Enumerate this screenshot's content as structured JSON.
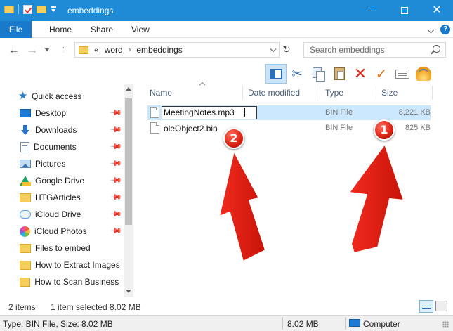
{
  "window": {
    "title": "embeddings"
  },
  "ribbon": {
    "file": "File",
    "tabs": [
      "Home",
      "Share",
      "View"
    ],
    "help": "?"
  },
  "address": {
    "overflow": "«",
    "crumbs": [
      "word",
      "embeddings"
    ],
    "search_placeholder": "Search embeddings"
  },
  "navpane": {
    "quick_access": "Quick access",
    "items": [
      {
        "label": "Desktop",
        "icon": "desktop-icon",
        "pinned": true
      },
      {
        "label": "Downloads",
        "icon": "downloads-icon",
        "pinned": true
      },
      {
        "label": "Documents",
        "icon": "documents-icon",
        "pinned": true
      },
      {
        "label": "Pictures",
        "icon": "pictures-icon",
        "pinned": true
      },
      {
        "label": "Google Drive",
        "icon": "google-drive-icon",
        "pinned": true
      },
      {
        "label": "HTGArticles",
        "icon": "folder-icon",
        "pinned": true
      },
      {
        "label": "iCloud Drive",
        "icon": "icloud-icon",
        "pinned": true
      },
      {
        "label": "iCloud Photos",
        "icon": "icloud-photos-icon",
        "pinned": true
      },
      {
        "label": "Files to embed",
        "icon": "folder-icon",
        "pinned": false
      },
      {
        "label": "How to Extract Images",
        "icon": "folder-icon",
        "pinned": false
      },
      {
        "label": "How to Scan Business C",
        "icon": "folder-icon",
        "pinned": false
      }
    ]
  },
  "columns": {
    "name": "Name",
    "date": "Date modified",
    "type": "Type",
    "size": "Size"
  },
  "files": [
    {
      "name": "MeetingNotes.mp3",
      "type": "BIN File",
      "size": "8,221 KB",
      "selected": true,
      "renaming": true
    },
    {
      "name": "oleObject2.bin",
      "type": "BIN File",
      "size": "825 KB",
      "selected": false,
      "renaming": false
    }
  ],
  "annotations": {
    "badge1": "1",
    "badge2": "2",
    "color": "#e8231a"
  },
  "status": {
    "items": "2 items",
    "selected": "1 item selected  8.02 MB"
  },
  "bottom": {
    "type_size": "Type: BIN File, Size: 8.02 MB",
    "size": "8.02 MB",
    "location": "Computer"
  },
  "colors": {
    "titlebar": "#1f8ad6",
    "file_tab": "#1979ca",
    "selection": "#cce8ff"
  }
}
